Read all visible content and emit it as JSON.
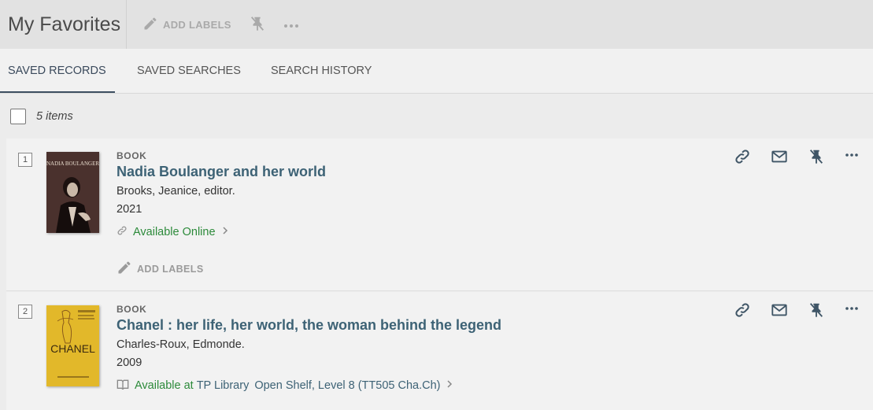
{
  "header": {
    "title": "My Favorites",
    "add_labels": "ADD LABELS"
  },
  "tabs": [
    {
      "label": "SAVED RECORDS",
      "active": true
    },
    {
      "label": "SAVED SEARCHES",
      "active": false
    },
    {
      "label": "SEARCH HISTORY",
      "active": false
    }
  ],
  "selection": {
    "count_label": "5 items"
  },
  "records": [
    {
      "number": "1",
      "type": "BOOK",
      "title": "Nadia Boulanger and her world",
      "author": "Brooks, Jeanice, editor.",
      "year": "2021",
      "availability": "Available Online",
      "add_labels": "ADD LABELS",
      "cover_text": "NADIA BOULANGER"
    },
    {
      "number": "2",
      "type": "BOOK",
      "title": "Chanel : her life, her world, the woman behind the legend",
      "author": "Charles-Roux, Edmonde.",
      "year": "2009",
      "availability_prefix": "Available at",
      "library": "TP Library",
      "location": "Open Shelf, Level 8 (TT505 Cha.Ch)",
      "cover_text": "CHANEL"
    }
  ],
  "colors": {
    "link_teal": "#3d6275",
    "available_green": "#2c8a3a",
    "icon_blue": "#3f5566"
  },
  "icons": [
    "pencil-icon",
    "unpin-icon",
    "more-icon",
    "link-icon",
    "mail-icon",
    "chevron-right-icon",
    "book-location-icon"
  ]
}
